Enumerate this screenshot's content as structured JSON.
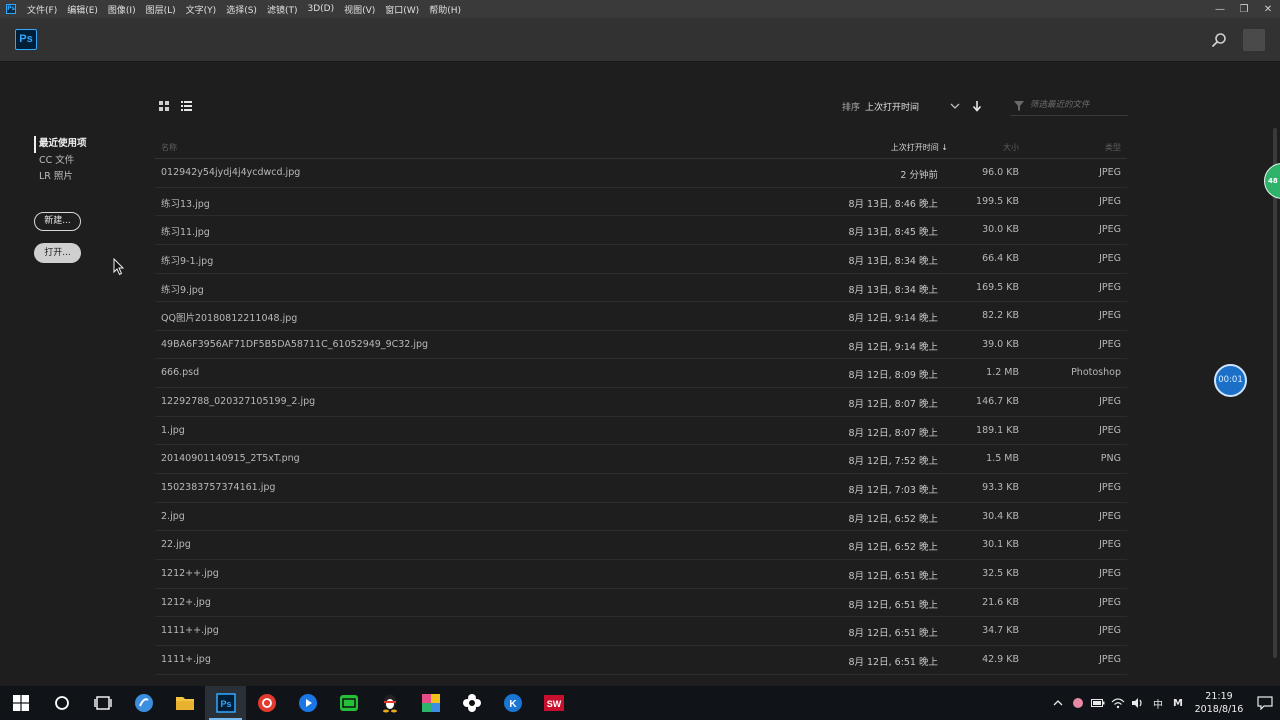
{
  "menubar": {
    "app_icon": "ps-mini-icon",
    "items": [
      "文件(F)",
      "编辑(E)",
      "图像(I)",
      "图层(L)",
      "文字(Y)",
      "选择(S)",
      "滤镜(T)",
      "3D(D)",
      "视图(V)",
      "窗口(W)",
      "帮助(H)"
    ],
    "window_controls": [
      "—",
      "❐",
      "✕"
    ]
  },
  "header": {
    "logo_text": "Ps",
    "accent_color": "#31a8ff"
  },
  "sidebar": {
    "nav": [
      {
        "label": "最近使用项",
        "active": true
      },
      {
        "label": "CC 文件",
        "active": false
      },
      {
        "label": "LR 照片",
        "active": false
      }
    ],
    "new_button": "新建...",
    "open_button": "打开..."
  },
  "toolbar": {
    "sort_label": "排序",
    "sort_value": "上次打开时间",
    "filter_placeholder": "筛选最近的文件"
  },
  "table": {
    "headers": {
      "name": "名称",
      "time": "上次打开时间 ↓",
      "size": "大小",
      "type": "类型"
    },
    "rows": [
      {
        "name": "012942y54jydj4j4ycdwcd.jpg",
        "time": "2 分钟前",
        "size": "96.0 KB",
        "type": "JPEG"
      },
      {
        "name": "练习13.jpg",
        "time": "8月 13日, 8:46 晚上",
        "size": "199.5 KB",
        "type": "JPEG"
      },
      {
        "name": "练习11.jpg",
        "time": "8月 13日, 8:45 晚上",
        "size": "30.0 KB",
        "type": "JPEG"
      },
      {
        "name": "练习9-1.jpg",
        "time": "8月 13日, 8:34 晚上",
        "size": "66.4 KB",
        "type": "JPEG"
      },
      {
        "name": "练习9.jpg",
        "time": "8月 13日, 8:34 晚上",
        "size": "169.5 KB",
        "type": "JPEG"
      },
      {
        "name": "QQ图片20180812211048.jpg",
        "time": "8月 12日, 9:14 晚上",
        "size": "82.2 KB",
        "type": "JPEG"
      },
      {
        "name": "49BA6F3956AF71DF5B5DA58711C_61052949_9C32.jpg",
        "time": "8月 12日, 9:14 晚上",
        "size": "39.0 KB",
        "type": "JPEG"
      },
      {
        "name": "666.psd",
        "time": "8月 12日, 8:09 晚上",
        "size": "1.2 MB",
        "type": "Photoshop"
      },
      {
        "name": "12292788_020327105199_2.jpg",
        "time": "8月 12日, 8:07 晚上",
        "size": "146.7 KB",
        "type": "JPEG"
      },
      {
        "name": "1.jpg",
        "time": "8月 12日, 8:07 晚上",
        "size": "189.1 KB",
        "type": "JPEG"
      },
      {
        "name": "20140901140915_2T5xT.png",
        "time": "8月 12日, 7:52 晚上",
        "size": "1.5 MB",
        "type": "PNG"
      },
      {
        "name": "1502383757374161.jpg",
        "time": "8月 12日, 7:03 晚上",
        "size": "93.3 KB",
        "type": "JPEG"
      },
      {
        "name": "2.jpg",
        "time": "8月 12日, 6:52 晚上",
        "size": "30.4 KB",
        "type": "JPEG"
      },
      {
        "name": "22.jpg",
        "time": "8月 12日, 6:52 晚上",
        "size": "30.1 KB",
        "type": "JPEG"
      },
      {
        "name": "1212++.jpg",
        "time": "8月 12日, 6:51 晚上",
        "size": "32.5 KB",
        "type": "JPEG"
      },
      {
        "name": "1212+.jpg",
        "time": "8月 12日, 6:51 晚上",
        "size": "21.6 KB",
        "type": "JPEG"
      },
      {
        "name": "1111++.jpg",
        "time": "8月 12日, 6:51 晚上",
        "size": "34.7 KB",
        "type": "JPEG"
      },
      {
        "name": "1111+.jpg",
        "time": "8月 12日, 6:51 晚上",
        "size": "42.9 KB",
        "type": "JPEG"
      }
    ]
  },
  "floating": {
    "green_badge": "48",
    "timer": "00:01"
  },
  "taskbar": {
    "apps": [
      "windows-start-icon",
      "cortana-search-icon",
      "task-view-icon",
      "sogou-browser-icon",
      "file-explorer-icon",
      "photoshop-icon",
      "netease-music-icon",
      "video-player-icon",
      "iqiyi-icon",
      "qq-penguin-icon",
      "colorful-app-icon",
      "flower-app-icon",
      "kugou-icon",
      "solidworks-icon"
    ],
    "tray": {
      "ime": "中",
      "ime_mode": "M",
      "time": "21:19",
      "date": "2018/8/16"
    }
  }
}
